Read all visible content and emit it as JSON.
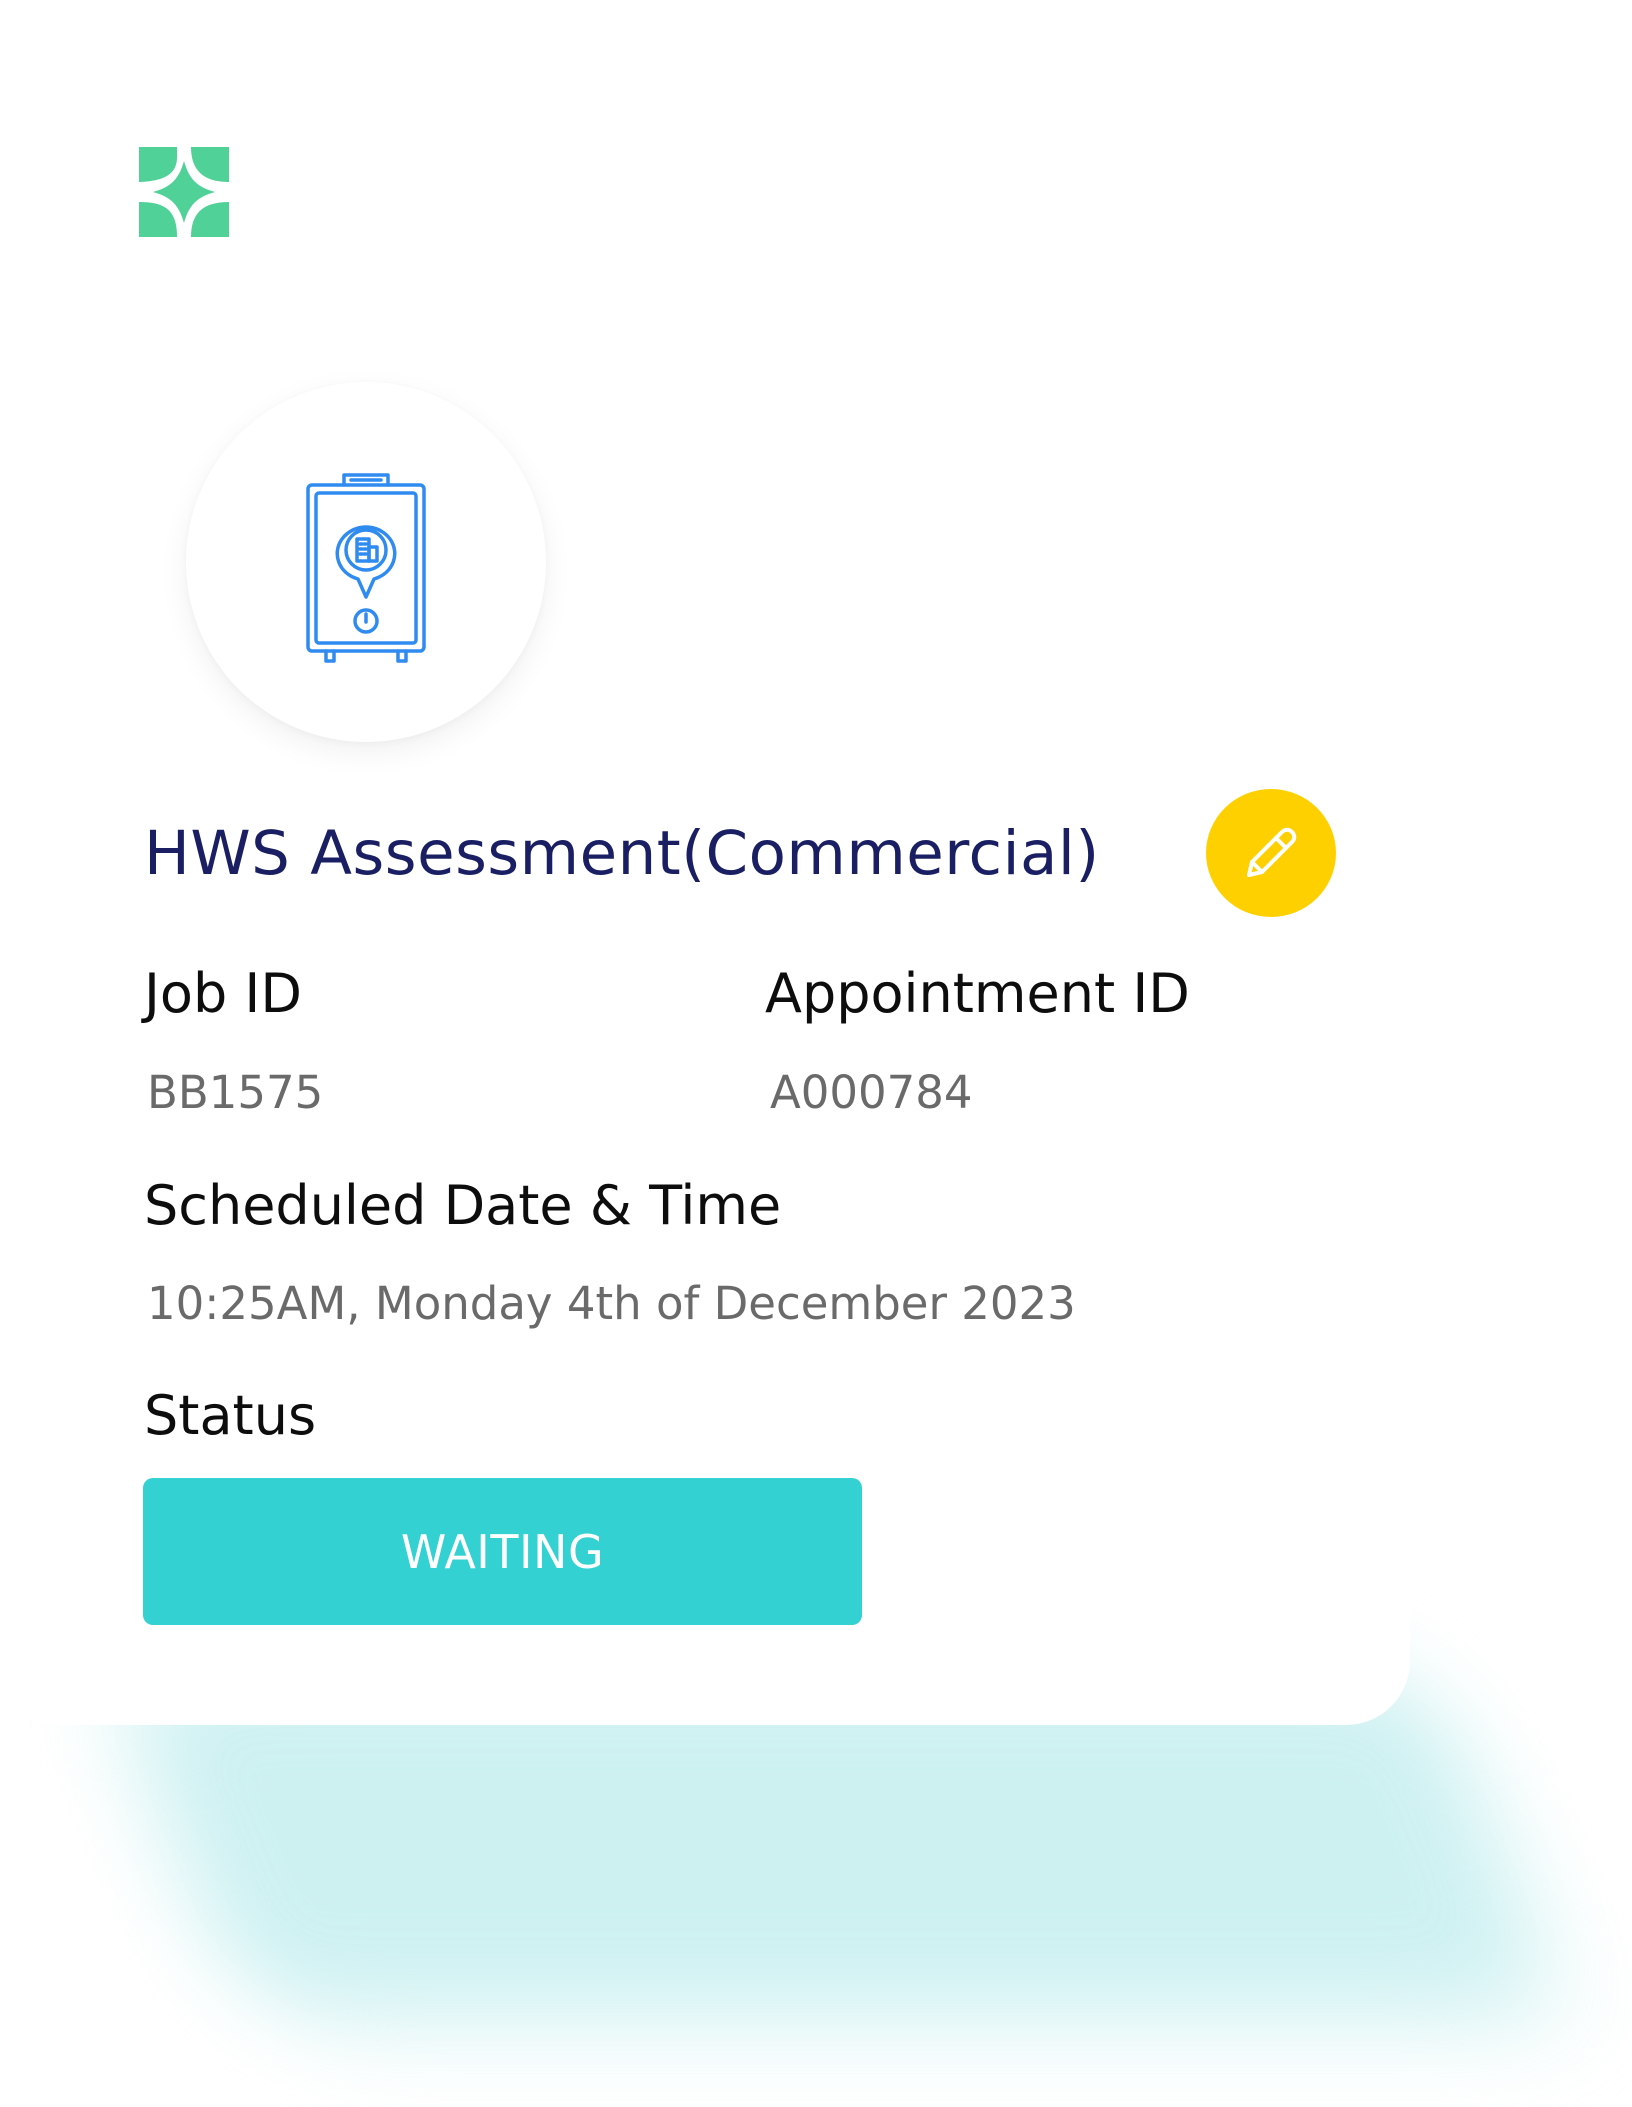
{
  "brand": {
    "logo_icon": "brand-logo-icon",
    "color": "#4fd197"
  },
  "job": {
    "icon": "water-heater-icon",
    "title": "HWS Assessment(Commercial)",
    "edit_icon": "pencil-icon",
    "fields": {
      "job_id_label": "Job ID",
      "job_id_value": "BB1575",
      "appointment_id_label": "Appointment ID",
      "appointment_id_value": "A000784",
      "scheduled_label": "Scheduled Date & Time",
      "scheduled_value": "10:25AM, Monday 4th of December 2023",
      "status_label": "Status",
      "status_value": "WAITING"
    }
  },
  "colors": {
    "title": "#1a1f63",
    "edit_button": "#ffd000",
    "status_badge": "#33d1d1",
    "icon_stroke": "#2f8bf0",
    "label": "#0d0d0d",
    "value": "#6a6a6a"
  }
}
